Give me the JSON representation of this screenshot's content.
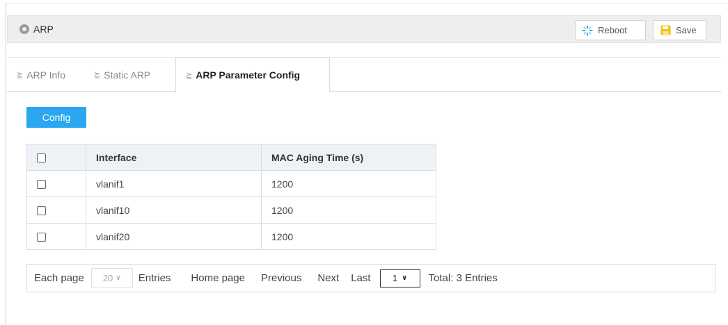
{
  "header": {
    "title": "ARP",
    "reboot_label": "Reboot",
    "save_label": "Save",
    "colors": {
      "reboot_icon": "#2aa7f0",
      "save_icon": "#f2c21b",
      "header_bg": "#eeeeee"
    }
  },
  "tabs": [
    {
      "label": "ARP Info",
      "active": false
    },
    {
      "label": "Static ARP",
      "active": false
    },
    {
      "label": "ARP Parameter Config",
      "active": true
    }
  ],
  "toolbar": {
    "config_label": "Config",
    "config_color": "#2aa7f0"
  },
  "table": {
    "columns": [
      "Interface",
      "MAC Aging Time (s)"
    ],
    "rows": [
      {
        "interface": "vlanif1",
        "mac_aging": "1200",
        "checked": false
      },
      {
        "interface": "vlanif10",
        "mac_aging": "1200",
        "checked": false
      },
      {
        "interface": "vlanif20",
        "mac_aging": "1200",
        "checked": false
      }
    ]
  },
  "pager": {
    "each_page_label": "Each page",
    "page_size": "20",
    "entries_label": "Entries",
    "home_label": "Home page",
    "previous_label": "Previous",
    "next_label": "Next",
    "last_label": "Last",
    "current_page": "1",
    "total_label": "Total: 3 Entries"
  }
}
